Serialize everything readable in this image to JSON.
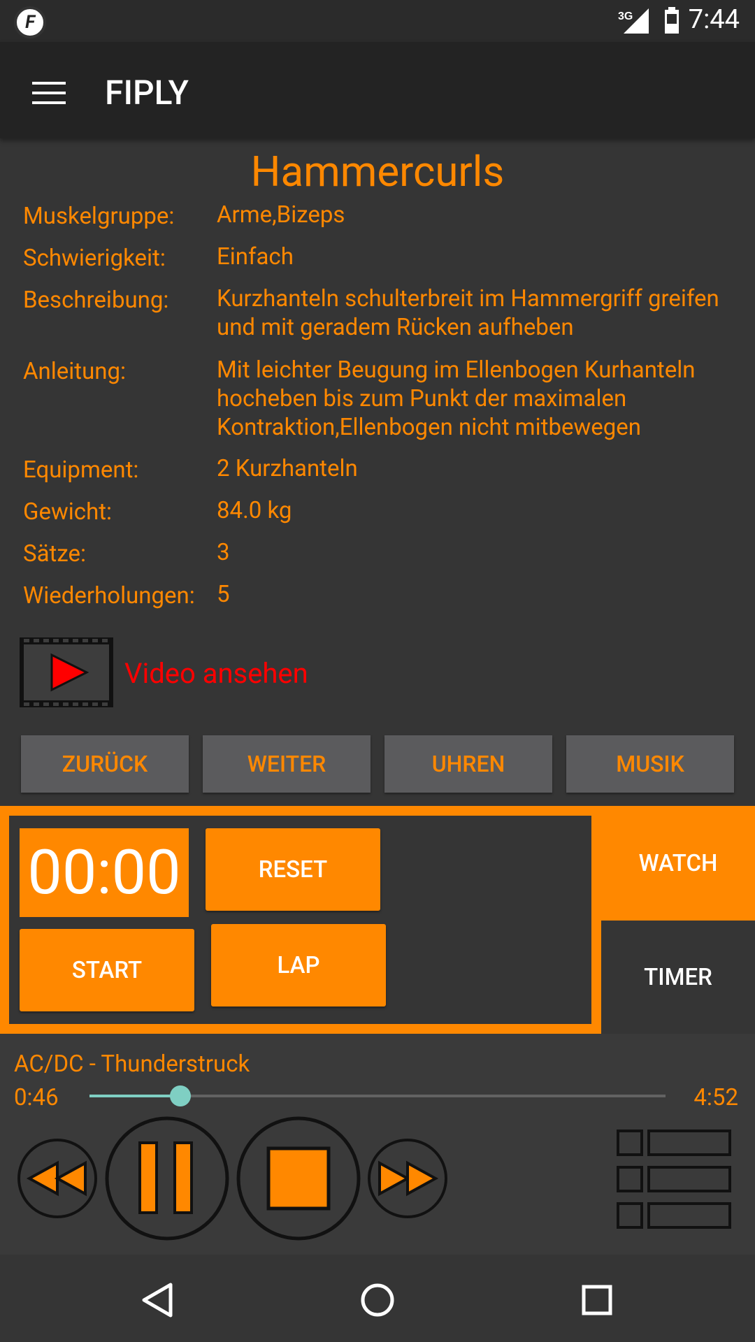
{
  "status_bar": {
    "time": "7:44",
    "network": "3G",
    "app_icon": "fiply-logo"
  },
  "app_bar": {
    "title": "FIPLY",
    "menu_icon": "hamburger-menu-icon"
  },
  "exercise": {
    "title": "Hammercurls",
    "fields": [
      {
        "label": "Muskelgruppe:",
        "value": "Arme,Bizeps"
      },
      {
        "label": "Schwierigkeit:",
        "value": "Einfach"
      },
      {
        "label": "Beschreibung:",
        "value": "Kurzhanteln schulterbreit im Hammergriff greifen und mit geradem Rücken aufheben"
      },
      {
        "label": "Anleitung:",
        "value": "Mit leichter Beugung im Ellenbogen Kurhanteln hocheben bis zum Punkt der maximalen Kontraktion,Ellenbogen nicht mitbewegen"
      },
      {
        "label": "Equipment:",
        "value": "2 Kurzhanteln"
      },
      {
        "label": "Gewicht:",
        "value": "84.0 kg"
      },
      {
        "label": "Sätze:",
        "value": "3"
      },
      {
        "label": "Wiederholungen:",
        "value": "5"
      }
    ]
  },
  "video": {
    "label": "Video ansehen"
  },
  "nav_buttons": [
    "ZURÜCK",
    "WEITER",
    "UHREN",
    "MUSIK"
  ],
  "watch": {
    "time": "00:00",
    "reset_label": "RESET",
    "start_label": "START",
    "lap_label": "LAP",
    "tabs": {
      "watch": "WATCH",
      "timer": "TIMER"
    }
  },
  "music": {
    "track": "AC/DC - Thunderstruck",
    "elapsed": "0:46",
    "total": "4:52",
    "progress": 0.158
  },
  "colors": {
    "accent": "#ff8800",
    "background": "#353535",
    "video_link": "#ff0000",
    "seek": "#7fcfc3"
  }
}
